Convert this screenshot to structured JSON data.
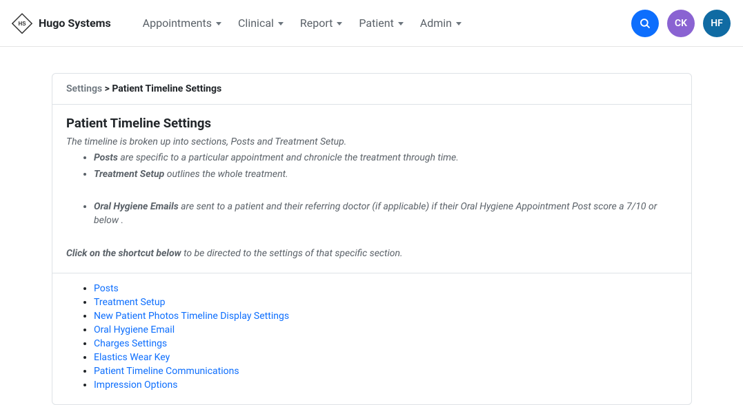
{
  "brand": {
    "name": "Hugo Systems"
  },
  "nav": {
    "items": [
      {
        "label": "Appointments"
      },
      {
        "label": "Clinical"
      },
      {
        "label": "Report"
      },
      {
        "label": "Patient"
      },
      {
        "label": "Admin"
      }
    ]
  },
  "topbarRight": {
    "avatar1": "CK",
    "avatar2": "HF"
  },
  "breadcrumb": {
    "root": "Settings",
    "sep": ">",
    "current": "Patient Timeline Settings"
  },
  "page": {
    "title": "Patient Timeline Settings",
    "intro": "The timeline is broken up into sections, Posts and Treatment Setup.",
    "bullets": [
      {
        "strong": "Posts",
        "rest": " are specific to a particular appointment and chronicle the treatment through time."
      },
      {
        "strong": "Treatment Setup",
        "rest": " outlines the whole treatment."
      },
      {
        "strong": "Oral Hygiene Emails",
        "rest": " are sent to a patient and their referring doctor (if applicable) if their Oral Hygiene Appointment Post score a 7/10 or below ."
      }
    ],
    "shortcutHintStrong": "Click on the shortcut below",
    "shortcutHintRest": " to be directed to the settings of that specific section."
  },
  "links": [
    "Posts",
    "Treatment Setup",
    "New Patient Photos Timeline Display Settings",
    "Oral Hygiene Email",
    "Charges Settings",
    "Elastics Wear Key",
    "Patient Timeline Communications",
    "Impression Options"
  ]
}
